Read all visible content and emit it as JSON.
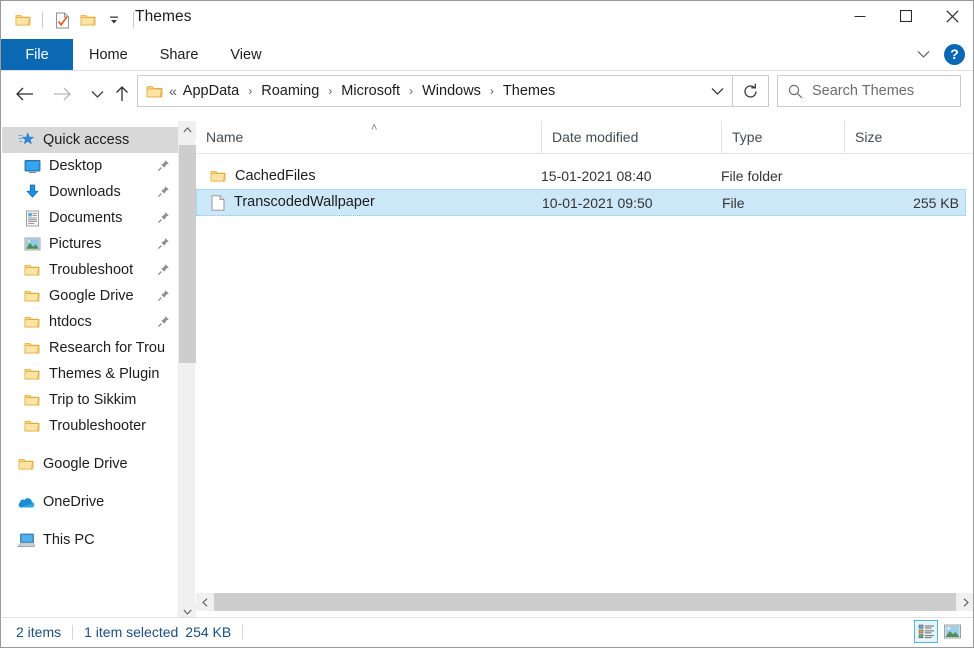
{
  "window": {
    "title": "Themes",
    "quick_access_toolbar": [
      {
        "name": "folder-icon",
        "label": "Folder"
      },
      {
        "name": "properties-icon",
        "label": "Properties"
      },
      {
        "name": "new-folder-icon",
        "label": "New folder"
      },
      {
        "name": "customize-dropdown-icon",
        "label": "Customize Quick Access Toolbar"
      }
    ],
    "caption": {
      "minimize": "Minimize",
      "maximize": "Maximize",
      "close": "Close"
    }
  },
  "ribbon": {
    "tabs": [
      {
        "label": "File",
        "active": true
      },
      {
        "label": "Home",
        "active": false
      },
      {
        "label": "Share",
        "active": false
      },
      {
        "label": "View",
        "active": false
      }
    ],
    "expand_label": "Expand the Ribbon",
    "help_label": "?"
  },
  "navigation": {
    "back": "Back",
    "forward": "Forward",
    "recent": "Recent locations",
    "up": "Up",
    "breadcrumb_overflow": "«",
    "breadcrumb": [
      "AppData",
      "Roaming",
      "Microsoft",
      "Windows",
      "Themes"
    ],
    "breadcrumb_separator": "›",
    "dropdown": "Previous locations",
    "refresh": "Refresh",
    "search": {
      "placeholder": "Search Themes",
      "value": ""
    }
  },
  "sidebar": {
    "items": [
      {
        "label": "Quick access",
        "icon": "quick-access-star-icon",
        "selected": true,
        "pinned": false,
        "indent": 0
      },
      {
        "label": "Desktop",
        "icon": "desktop-icon",
        "selected": false,
        "pinned": true,
        "indent": 1
      },
      {
        "label": "Downloads",
        "icon": "downloads-icon",
        "selected": false,
        "pinned": true,
        "indent": 1
      },
      {
        "label": "Documents",
        "icon": "documents-icon",
        "selected": false,
        "pinned": true,
        "indent": 1
      },
      {
        "label": "Pictures",
        "icon": "pictures-icon",
        "selected": false,
        "pinned": true,
        "indent": 1
      },
      {
        "label": "Troubleshoot",
        "icon": "folder-icon",
        "selected": false,
        "pinned": true,
        "indent": 1
      },
      {
        "label": "Google Drive",
        "icon": "folder-icon",
        "selected": false,
        "pinned": true,
        "indent": 1
      },
      {
        "label": "htdocs",
        "icon": "folder-icon",
        "selected": false,
        "pinned": true,
        "indent": 1
      },
      {
        "label": "Research for Trou",
        "icon": "folder-icon",
        "selected": false,
        "pinned": false,
        "indent": 1
      },
      {
        "label": "Themes & Plugin",
        "icon": "folder-icon",
        "selected": false,
        "pinned": false,
        "indent": 1
      },
      {
        "label": "Trip to Sikkim",
        "icon": "folder-icon",
        "selected": false,
        "pinned": false,
        "indent": 1
      },
      {
        "label": "Troubleshooter",
        "icon": "folder-icon",
        "selected": false,
        "pinned": false,
        "indent": 1
      },
      {
        "label": "Google Drive",
        "icon": "folder-icon",
        "selected": false,
        "pinned": false,
        "indent": 0
      },
      {
        "label": "OneDrive",
        "icon": "onedrive-cloud-icon",
        "selected": false,
        "pinned": false,
        "indent": 0
      },
      {
        "label": "This PC",
        "icon": "this-pc-icon",
        "selected": false,
        "pinned": false,
        "indent": 0
      }
    ]
  },
  "file_list": {
    "columns": [
      {
        "label": "Name",
        "sorted": true,
        "sort_direction": "ascending"
      },
      {
        "label": "Date modified",
        "sorted": false
      },
      {
        "label": "Type",
        "sorted": false
      },
      {
        "label": "Size",
        "sorted": false
      }
    ],
    "sort_indicator": "˄",
    "rows": [
      {
        "name": "CachedFiles",
        "date_modified": "15-01-2021 08:40",
        "type": "File folder",
        "size": "",
        "icon": "folder-icon",
        "selected": false
      },
      {
        "name": "TranscodedWallpaper",
        "date_modified": "10-01-2021 09:50",
        "type": "File",
        "size": "255 KB",
        "icon": "file-icon",
        "selected": true
      }
    ]
  },
  "status_bar": {
    "item_count": "2 items",
    "selection": "1 item selected",
    "selection_size": "254 KB",
    "views": [
      {
        "name": "details-view-button",
        "label": "Details view",
        "active": true
      },
      {
        "name": "large-icons-view-button",
        "label": "Large icons view",
        "active": false
      }
    ]
  },
  "colors": {
    "accent_blue": "#0b69b4",
    "selection_fill": "#cce8f8",
    "selection_border": "#a6d9f4",
    "sidebar_selected": "#d8d8d8",
    "status_text": "#1b4f82",
    "folder_yellow": "#fdd980"
  }
}
